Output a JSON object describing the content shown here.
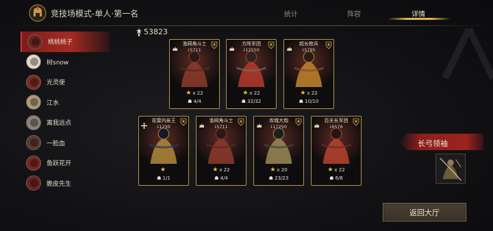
{
  "header": {
    "title": "竞技场模式-单人·第一名",
    "tabs": [
      {
        "label": "统计"
      },
      {
        "label": "阵容"
      },
      {
        "label": "详情"
      }
    ],
    "active_tab": "详情"
  },
  "players": [
    {
      "name": "桃桃桃子",
      "active": true,
      "avatar_color": "#6e2420"
    },
    {
      "name": "树snow",
      "active": false,
      "avatar_color": "#e6d6cc"
    },
    {
      "name": "光灵使",
      "active": false,
      "avatar_color": "#7d2a26"
    },
    {
      "name": "江水",
      "active": false,
      "avatar_color": "#b09a7a"
    },
    {
      "name": "离我远点",
      "active": false,
      "avatar_color": "#8a8478"
    },
    {
      "name": "一脸血",
      "active": false,
      "avatar_color": "#5c3a30"
    },
    {
      "name": "鱼跃花开",
      "active": false,
      "avatar_color": "#7a2622"
    },
    {
      "name": "脆皮先生",
      "active": false,
      "avatar_color": "#6a2220"
    }
  ],
  "power": "53823",
  "units_row1": [
    {
      "name": "渔网角斗士",
      "power": "5711",
      "stars": "x 22",
      "troops": "4/4",
      "icon": "wolf-icon",
      "palette": [
        "#5a2a22",
        "#8c3b2c",
        "#2a1a16"
      ]
    },
    {
      "name": "方阵军团",
      "power": "12550",
      "stars": "x 22",
      "troops": "32/32",
      "icon": "wolf-icon",
      "palette": [
        "#7a6a55",
        "#b33a2e",
        "#2b2420"
      ]
    },
    {
      "name": "超长枪兵",
      "power": "5795",
      "stars": "x 22",
      "troops": "10/10",
      "icon": "wolf-icon",
      "palette": [
        "#8a4a2a",
        "#c2852f",
        "#2a1c14"
      ]
    }
  ],
  "units_row2": [
    {
      "name": "花雷内亲王",
      "power": "1230",
      "stars": "",
      "troops": "1/1",
      "icon": "cross-icon",
      "palette": [
        "#2c3466",
        "#b08a3a",
        "#15182c"
      ]
    },
    {
      "name": "渔网角斗士",
      "power": "5711",
      "stars": "x 22",
      "troops": "4/4",
      "icon": "wolf-icon",
      "palette": [
        "#5a2a22",
        "#8c3b2c",
        "#2a1a16"
      ]
    },
    {
      "name": "攻城大炮",
      "power": "17250",
      "stars": "x 20",
      "troops": "23/23",
      "icon": "wolf-icon",
      "palette": [
        "#3e4a3a",
        "#9a8a58",
        "#1e201a"
      ]
    },
    {
      "name": "百夫长军团",
      "power": "6576",
      "stars": "x 22",
      "troops": "6/6",
      "icon": "wolf-icon",
      "palette": [
        "#6a2a24",
        "#b9432f",
        "#241512"
      ]
    }
  ],
  "commander": {
    "label": "长弓领袖"
  },
  "return_button": "返回大厅"
}
